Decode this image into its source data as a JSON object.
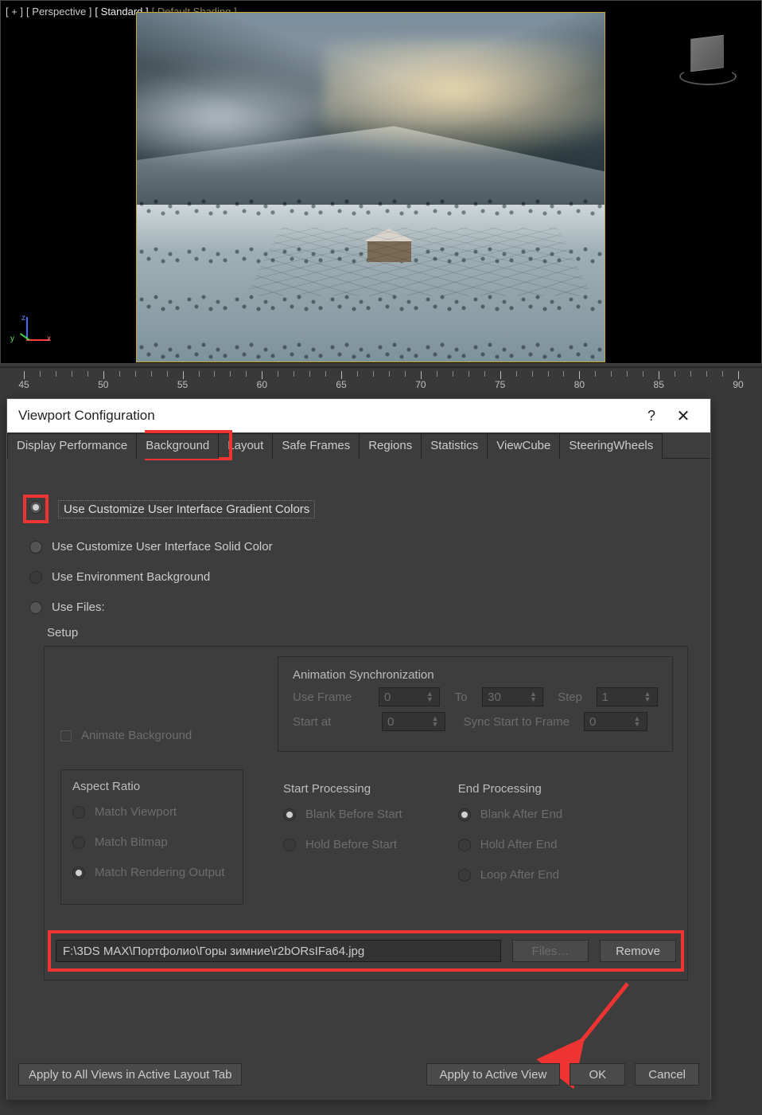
{
  "viewport": {
    "labels": {
      "plus": "[ + ]",
      "view": "[ Perspective ]",
      "preset": "[ Standard ]",
      "shading": "[ Default Shading ]"
    },
    "gizmo": {
      "x": "x",
      "y": "y",
      "z": "z"
    }
  },
  "ruler": {
    "majors": [
      45,
      50,
      55,
      60,
      65,
      70,
      75,
      80,
      85,
      90
    ]
  },
  "dialog": {
    "title": "Viewport Configuration",
    "help": "?",
    "close": "✕",
    "tabs": [
      "Display Performance",
      "Background",
      "Layout",
      "Safe Frames",
      "Regions",
      "Statistics",
      "ViewCube",
      "SteeringWheels"
    ],
    "active_tab": 1,
    "radios": {
      "r1": "Use Customize User Interface Gradient Colors",
      "r2": "Use Customize User Interface Solid Color",
      "r3": "Use Environment Background",
      "r4": "Use Files:"
    },
    "setup_label": "Setup",
    "animsync": {
      "title": "Animation Synchronization",
      "use_frame": "Use Frame",
      "use_frame_v": "0",
      "to": "To",
      "to_v": "30",
      "step": "Step",
      "step_v": "1",
      "start_at": "Start at",
      "start_at_v": "0",
      "sync": "Sync Start to Frame",
      "sync_v": "0"
    },
    "animate_bg": "Animate Background",
    "aspect": {
      "title": "Aspect Ratio",
      "o1": "Match Viewport",
      "o2": "Match Bitmap",
      "o3": "Match Rendering Output"
    },
    "startproc": {
      "title": "Start Processing",
      "o1": "Blank Before Start",
      "o2": "Hold Before Start"
    },
    "endproc": {
      "title": "End Processing",
      "o1": "Blank After End",
      "o2": "Hold After End",
      "o3": "Loop After End"
    },
    "path": "F:\\3DS MAX\\Портфолио\\Горы зимние\\r2bORsIFa64.jpg",
    "files_btn": "Files…",
    "remove_btn": "Remove",
    "footer": {
      "apply_all": "Apply to All Views in Active Layout Tab",
      "apply_active": "Apply to Active View",
      "ok": "OK",
      "cancel": "Cancel"
    }
  }
}
